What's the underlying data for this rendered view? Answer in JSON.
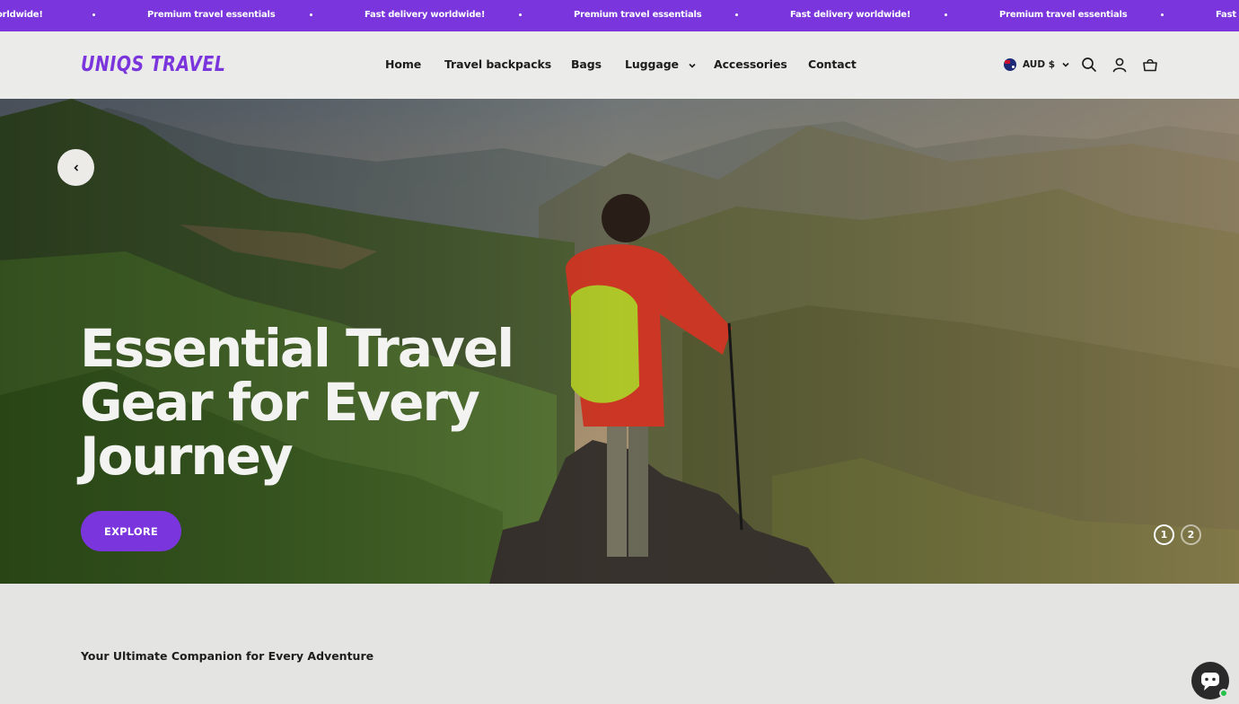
{
  "announcement": {
    "items": [
      "orldwide!",
      "Premium travel essentials",
      "Fast delivery worldwide!",
      "Premium travel essentials",
      "Fast delivery worldwide!",
      "Premium travel essentials",
      "Fast d"
    ]
  },
  "header": {
    "logo": "UNIQS TRAVEL",
    "nav": [
      "Home",
      "Travel backpacks",
      "Bags",
      "Luggage",
      "Accessories",
      "Contact"
    ],
    "currency": "AUD $",
    "icons": [
      "search-icon",
      "account-icon",
      "cart-icon"
    ]
  },
  "hero": {
    "title_lines": [
      "Essential Travel",
      "Gear for Every",
      "Journey"
    ],
    "cta": "EXPLORE",
    "slides": [
      "1",
      "2"
    ],
    "active_slide": "1"
  },
  "section": {
    "subtitle": "Your Ultimate Companion for Every Adventure"
  },
  "colors": {
    "brand": "#7a36dc",
    "header_bg": "#ebebe9",
    "page_bg": "#e4e4e2"
  }
}
